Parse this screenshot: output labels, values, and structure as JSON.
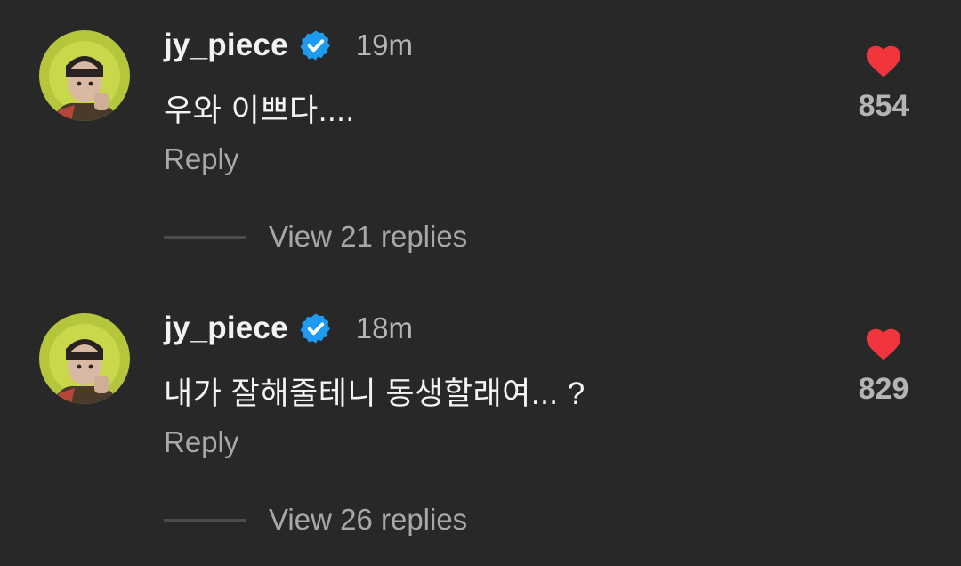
{
  "comments": [
    {
      "username": "jy_piece",
      "time": "19m",
      "text": "우와 이쁘다....",
      "reply_label": "Reply",
      "view_replies_label": "View 21 replies",
      "like_count": "854",
      "icons": {
        "avatar": "profile-avatar",
        "verified": "verified-badge-icon",
        "like": "heart-icon"
      }
    },
    {
      "username": "jy_piece",
      "time": "18m",
      "text": "내가 잘해줄테니 동생할래여... ?",
      "reply_label": "Reply",
      "view_replies_label": "View 26 replies",
      "like_count": "829",
      "icons": {
        "avatar": "profile-avatar",
        "verified": "verified-badge-icon",
        "like": "heart-icon"
      }
    }
  ],
  "colors": {
    "background": "#282828",
    "username": "#f2f2f2",
    "muted_text": "#a8a8a8",
    "verified_blue": "#1d9bf0",
    "like_red": "#f0353f"
  }
}
